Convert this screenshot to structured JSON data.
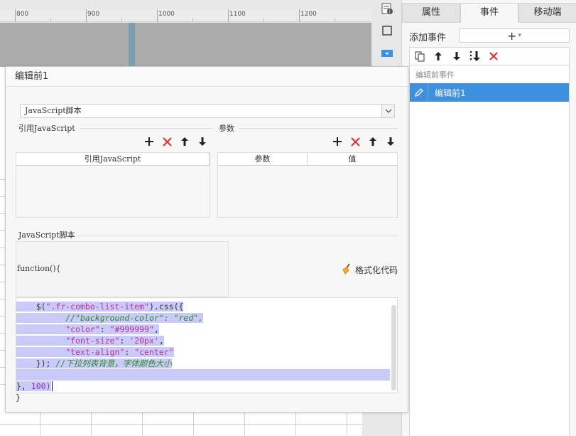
{
  "ruler": {
    "labels": [
      "800",
      "900",
      "1000",
      "1100",
      "1200"
    ]
  },
  "toolstrip": {
    "icons": [
      "report-icon",
      "square-icon",
      "dropdown-widget-icon"
    ]
  },
  "right_panel": {
    "tabs": [
      {
        "label": "属性",
        "active": false
      },
      {
        "label": "事件",
        "active": true
      },
      {
        "label": "移动端",
        "active": false
      }
    ],
    "add_event_label": "添加事件",
    "add_event_button": "+",
    "event_group": "编辑前事件",
    "event_item": "编辑前1"
  },
  "dialog": {
    "title": "编辑前1",
    "script_type": "JavaScript脚本",
    "ref_section_label": "引用JavaScript",
    "param_section_label": "参数",
    "ref_table_header": "引用JavaScript",
    "param_table_headers": [
      "参数",
      "值"
    ],
    "script_section_label": "JavaScript脚本",
    "function_header": "function(){",
    "format_button": "格式化代码",
    "code": {
      "line0": "$(\".fr-combo-list-item\").css({",
      "line0_selector": "\".fr-combo-list-item\"",
      "line1": "//\"background-color\": \"red\",",
      "line2_key": "\"color\"",
      "line2_val": "\"#999999\"",
      "line3_key": "\"font-size\"",
      "line3_val": "'20px'",
      "line4_key": "\"text-align\"",
      "line4_val": "\"center\"",
      "line5_code": "});",
      "line5_comment": "//下拉列表背景，字体颜色大小",
      "line7_brace": "},",
      "line7_num": "100)"
    },
    "closing_brace": "}"
  },
  "colors": {
    "selection": "#c9caf7",
    "accent_blue": "#3d8fe0",
    "delete_red": "#e03434",
    "string_magenta": "#c0309b",
    "comment_green": "#2c8a2c"
  }
}
